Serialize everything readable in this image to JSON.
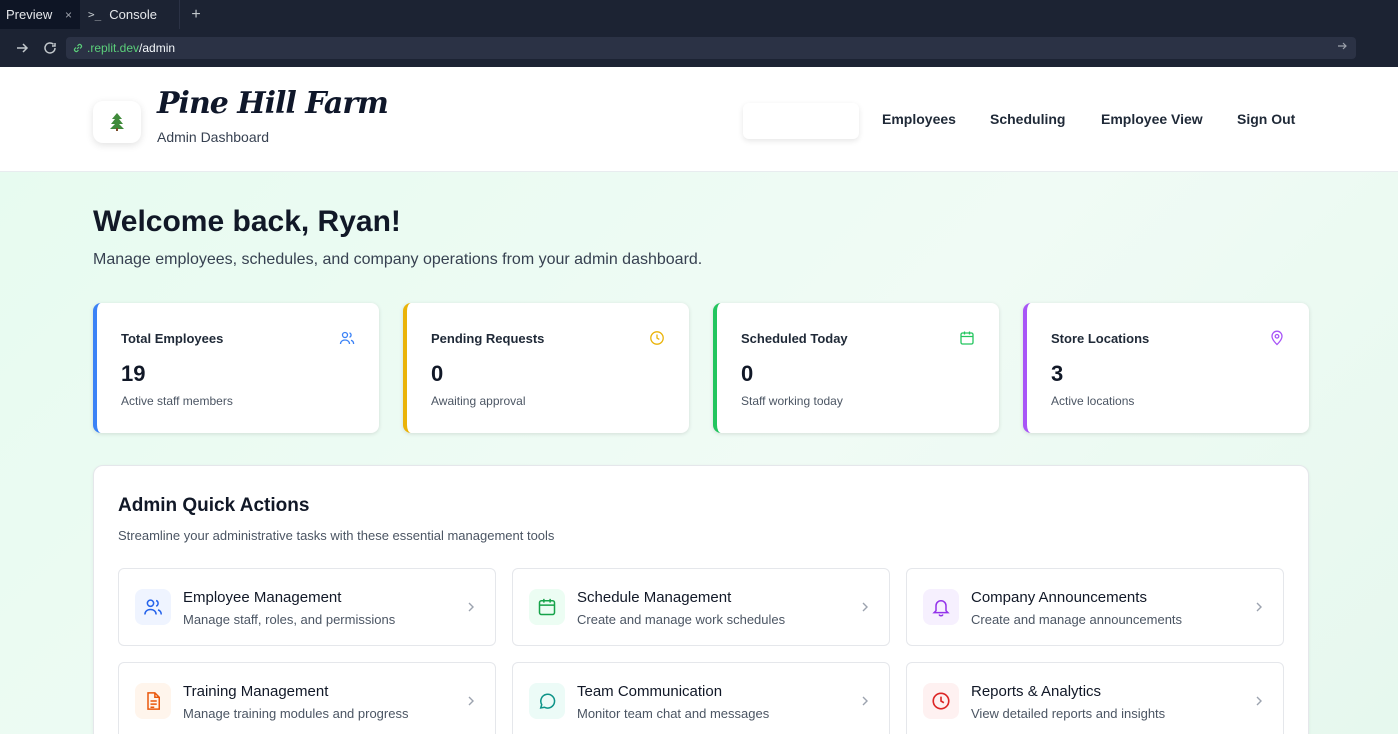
{
  "browser": {
    "tabs": [
      {
        "label": "Preview",
        "close": "×"
      },
      {
        "label": "Console",
        "prompt": ">_"
      }
    ],
    "add_tab": "+",
    "url": {
      "domain": ".replit.dev",
      "path": "/admin"
    }
  },
  "header": {
    "brand_name": "Pine Hill Farm",
    "brand_subtitle": "Admin Dashboard",
    "logo_icon": "pine-tree-icon",
    "nav": [
      "Employees",
      "Scheduling",
      "Employee View",
      "Sign Out"
    ]
  },
  "welcome": {
    "title": "Welcome back, Ryan!",
    "subtitle": "Manage employees, schedules, and company operations from your admin dashboard."
  },
  "stats": [
    {
      "title": "Total Employees",
      "value": "19",
      "description": "Active staff members",
      "icon": "users-icon",
      "color": "#3b82f6"
    },
    {
      "title": "Pending Requests",
      "value": "0",
      "description": "Awaiting approval",
      "icon": "clock-icon",
      "color": "#eab308"
    },
    {
      "title": "Scheduled Today",
      "value": "0",
      "description": "Staff working today",
      "icon": "calendar-icon",
      "color": "#22c55e"
    },
    {
      "title": "Store Locations",
      "value": "3",
      "description": "Active locations",
      "icon": "map-pin-icon",
      "color": "#a855f7"
    }
  ],
  "quick_actions": {
    "title": "Admin Quick Actions",
    "subtitle": "Streamline your administrative tasks with these essential management tools",
    "items": [
      {
        "title": "Employee Management",
        "description": "Manage staff, roles, and permissions",
        "icon": "users-icon",
        "color": "#2563eb",
        "bg": "#eff4ff"
      },
      {
        "title": "Schedule Management",
        "description": "Create and manage work schedules",
        "icon": "calendar-icon",
        "color": "#16a34a",
        "bg": "#ecfdf3"
      },
      {
        "title": "Company Announcements",
        "description": "Create and manage announcements",
        "icon": "bell-icon",
        "color": "#9333ea",
        "bg": "#f6f0fe"
      },
      {
        "title": "Training Management",
        "description": "Manage training modules and progress",
        "icon": "document-icon",
        "color": "#ea580c",
        "bg": "#fff5ec"
      },
      {
        "title": "Team Communication",
        "description": "Monitor team chat and messages",
        "icon": "chat-bubble-icon",
        "color": "#0d9488",
        "bg": "#ecfbf7"
      },
      {
        "title": "Reports & Analytics",
        "description": "View detailed reports and insights",
        "icon": "clock-icon",
        "color": "#dc2626",
        "bg": "#fef1f1"
      }
    ]
  }
}
